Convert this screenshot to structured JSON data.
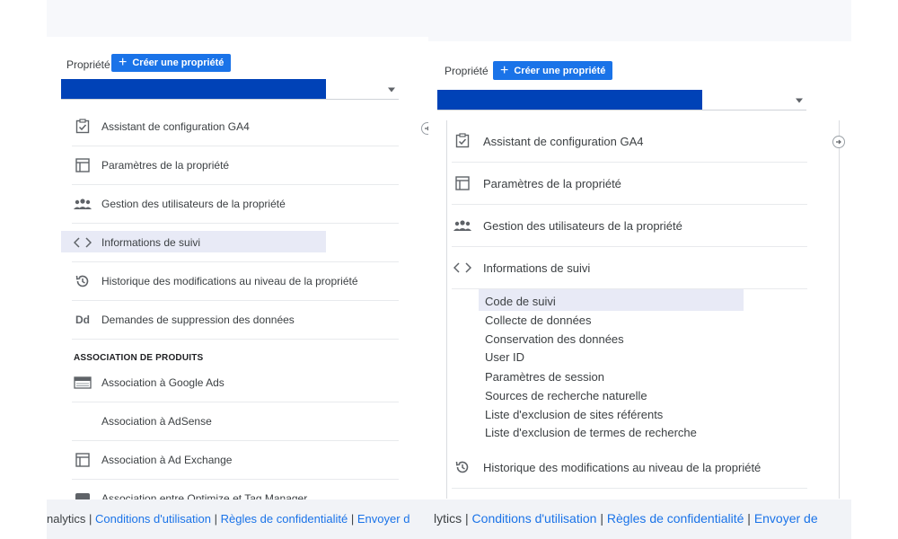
{
  "left": {
    "property_label": "Propriété",
    "create_label": "Créer une propriété",
    "items": [
      {
        "label": "Assistant de configuration GA4",
        "icon": "clipboard-check-icon"
      },
      {
        "label": "Paramètres de la propriété",
        "icon": "layout-icon"
      },
      {
        "label": "Gestion des utilisateurs de la propriété",
        "icon": "people-icon"
      },
      {
        "label": "Informations de suivi",
        "icon": "code-icon"
      },
      {
        "label": "Historique des modifications au niveau de la propriété",
        "icon": "history-icon"
      },
      {
        "label": "Demandes de suppression des données",
        "icon": "dd-icon",
        "icon_text": "Dd"
      }
    ],
    "section_title": "ASSOCIATION DE PRODUITS",
    "product_links": [
      {
        "label": "Association à Google Ads",
        "icon": "ads-icon"
      },
      {
        "label": "Association à AdSense",
        "icon": "none"
      },
      {
        "label": "Association à Ad Exchange",
        "icon": "layout-icon"
      },
      {
        "label": "Association entre Optimize et Tag Manager",
        "icon": "optimize-icon"
      }
    ]
  },
  "right": {
    "property_label": "Propriété",
    "create_label": "Créer une propriété",
    "items": [
      {
        "label": "Assistant de configuration GA4",
        "icon": "clipboard-check-icon"
      },
      {
        "label": "Paramètres de la propriété",
        "icon": "layout-icon"
      },
      {
        "label": "Gestion des utilisateurs de la propriété",
        "icon": "people-icon"
      },
      {
        "label": "Informations de suivi",
        "icon": "code-icon"
      }
    ],
    "sub_items": [
      "Code de suivi",
      "Collecte de données",
      "Conservation des données",
      "User ID",
      "Paramètres de session",
      "Sources de recherche naturelle",
      "Liste d'exclusion de sites référents",
      "Liste d'exclusion de termes de recherche"
    ],
    "history_label": "Historique des modifications au niveau de la propriété"
  },
  "footer": {
    "left_prefix": "nalytics",
    "left_terms": "Conditions d'utilisation",
    "left_privacy": "Règles de confidentialité",
    "left_send": "Envoyer d",
    "right_prefix": "lytics",
    "right_terms": "Conditions d'utilisation",
    "right_privacy": "Règles de confidentialité",
    "right_send": "Envoyer de",
    "separator": "|"
  },
  "colors": {
    "accent": "#1a73e8",
    "property_bar": "#0042b7",
    "highlight": "#e8eaf6"
  }
}
